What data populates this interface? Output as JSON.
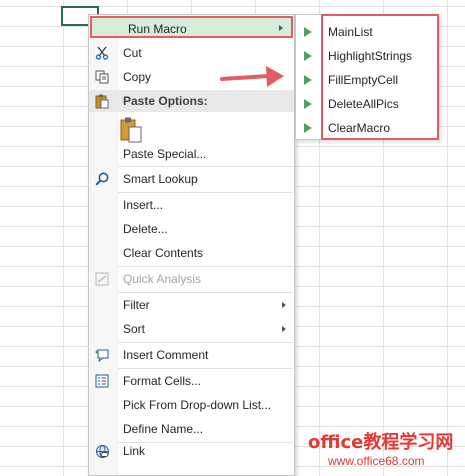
{
  "context_menu": {
    "items": [
      {
        "label": "Run Macro",
        "icon": "none",
        "submenu": true
      },
      {
        "label": "Cut",
        "icon": "scissors-icon"
      },
      {
        "label": "Copy",
        "icon": "copy-icon"
      },
      {
        "label": "Paste Options:",
        "icon": "paste-icon",
        "header": true
      },
      {
        "label": "Paste Special...",
        "icon": "none"
      },
      {
        "label": "Smart Lookup",
        "icon": "search-icon"
      },
      {
        "label": "Insert...",
        "icon": "none"
      },
      {
        "label": "Delete...",
        "icon": "none"
      },
      {
        "label": "Clear Contents",
        "icon": "none"
      },
      {
        "label": "Quick Analysis",
        "icon": "quick-analysis-icon",
        "disabled": true
      },
      {
        "label": "Filter",
        "icon": "none",
        "submenu": true
      },
      {
        "label": "Sort",
        "icon": "none",
        "submenu": true
      },
      {
        "label": "Insert Comment",
        "icon": "comment-icon"
      },
      {
        "label": "Format Cells...",
        "icon": "format-cells-icon"
      },
      {
        "label": "Pick From Drop-down List...",
        "icon": "none"
      },
      {
        "label": "Define Name...",
        "icon": "none"
      },
      {
        "label": "Link",
        "icon": "link-icon"
      }
    ]
  },
  "macro_submenu": {
    "items": [
      {
        "label": "MainList"
      },
      {
        "label": "HighlightStrings"
      },
      {
        "label": "FillEmptyCell"
      },
      {
        "label": "DeleteAllPics"
      },
      {
        "label": "ClearMacro"
      }
    ]
  },
  "watermark": {
    "line1": "office教程学习网",
    "line2": "www.office68.com"
  },
  "colors": {
    "highlight_red": "#e35b63",
    "run_macro_bg": "#d5ecd9",
    "play_green": "#4aa564",
    "cell_border": "#217346"
  }
}
